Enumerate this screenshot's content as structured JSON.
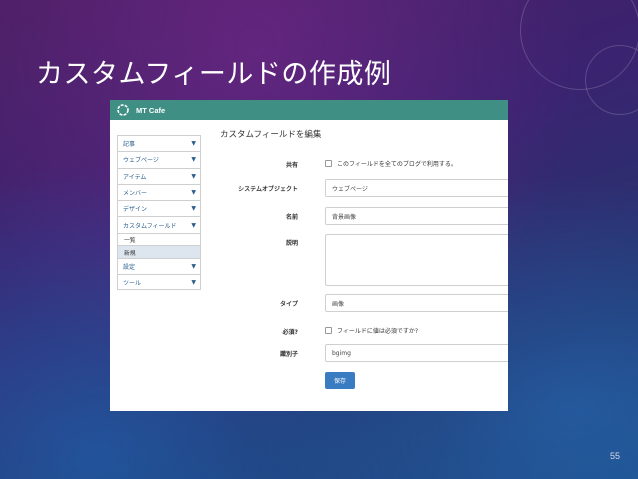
{
  "slide": {
    "title": "カスタムフィールドの作成例",
    "page_number": "55"
  },
  "app": {
    "brand": "MT Cafe",
    "accent_color": "#3f8f84",
    "button_color": "#3a7cc1"
  },
  "sidebar": {
    "items": [
      {
        "label": "記事",
        "icon": "chevron-down-icon"
      },
      {
        "label": "ウェブページ",
        "icon": "chevron-down-icon"
      },
      {
        "label": "アイテム",
        "icon": "chevron-down-icon"
      },
      {
        "label": "メンバー",
        "icon": "chevron-down-icon"
      },
      {
        "label": "デザイン",
        "icon": "chevron-down-icon"
      },
      {
        "label": "カスタムフィールド",
        "icon": "chevron-down-icon"
      }
    ],
    "subitems": [
      {
        "label": "一覧"
      },
      {
        "label": "新規"
      }
    ],
    "items_after": [
      {
        "label": "設定",
        "icon": "chevron-down-icon"
      },
      {
        "label": "ツール",
        "icon": "chevron-down-icon"
      }
    ]
  },
  "form": {
    "title": "カスタムフィールドを編集",
    "shared_label": "共有",
    "shared_text": "このフィールドを全てのブログで利用する。",
    "object_label": "システムオブジェクト",
    "object_value": "ウェブページ",
    "name_label": "名前",
    "name_value": "背景画像",
    "description_label": "説明",
    "type_label": "タイプ",
    "type_value": "画像",
    "required_label": "必須?",
    "required_text": "フィールドに値は必須ですか?",
    "identifier_label": "識別子",
    "identifier_value": "bgimg",
    "save_label": "保存"
  }
}
